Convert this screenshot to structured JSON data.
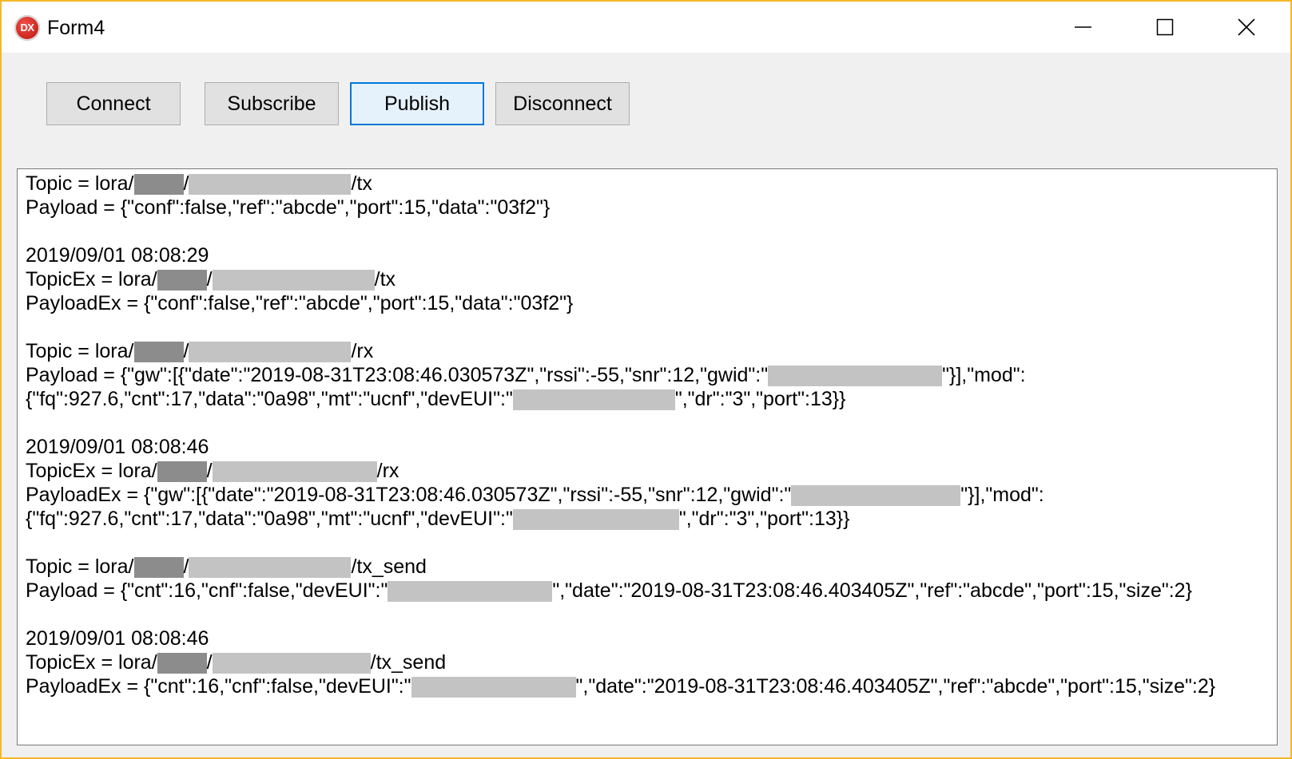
{
  "window": {
    "title": "Form4",
    "icon_label": "DX",
    "accent_color": "#f5b82a"
  },
  "toolbar": {
    "connect_label": "Connect",
    "subscribe_label": "Subscribe",
    "publish_label": "Publish",
    "disconnect_label": "Disconnect"
  },
  "log": {
    "entries": [
      {
        "parts": [
          "Topic = lora/",
          "[redacted-dark]",
          "/",
          "[redacted]",
          "/tx"
        ]
      },
      {
        "parts": [
          "Payload = {\"conf\":false,\"ref\":\"abcde\",\"port\":15,\"data\":\"03f2\"}"
        ]
      },
      {
        "parts": [
          ""
        ]
      },
      {
        "parts": [
          "2019/09/01 08:08:29"
        ]
      },
      {
        "parts": [
          "TopicEx = lora/",
          "[redacted-dark]",
          "/",
          "[redacted]",
          "/tx"
        ]
      },
      {
        "parts": [
          "PayloadEx = {\"conf\":false,\"ref\":\"abcde\",\"port\":15,\"data\":\"03f2\"}"
        ]
      },
      {
        "parts": [
          ""
        ]
      },
      {
        "parts": [
          "Topic = lora/",
          "[redacted-dark]",
          "/",
          "[redacted]",
          "/rx"
        ]
      },
      {
        "parts": [
          "Payload = {\"gw\":[{\"date\":\"2019-08-31T23:08:46.030573Z\",\"rssi\":-55,\"snr\":12,\"gwid\":\"",
          "[redacted]",
          "\"}],\"mod\":"
        ]
      },
      {
        "parts": [
          "{\"fq\":927.6,\"cnt\":17,\"data\":\"0a98\",\"mt\":\"ucnf\",\"devEUI\":\"",
          "[redacted]",
          "\",\"dr\":\"3\",\"port\":13}}"
        ]
      },
      {
        "parts": [
          ""
        ]
      },
      {
        "parts": [
          "2019/09/01 08:08:46"
        ]
      },
      {
        "parts": [
          "TopicEx = lora/",
          "[redacted-dark]",
          "/",
          "[redacted]",
          "/rx"
        ]
      },
      {
        "parts": [
          "PayloadEx = {\"gw\":[{\"date\":\"2019-08-31T23:08:46.030573Z\",\"rssi\":-55,\"snr\":12,\"gwid\":\"",
          "[redacted]",
          "\"}],\"mod\":"
        ]
      },
      {
        "parts": [
          "{\"fq\":927.6,\"cnt\":17,\"data\":\"0a98\",\"mt\":\"ucnf\",\"devEUI\":\"",
          "[redacted]",
          "\",\"dr\":\"3\",\"port\":13}}"
        ]
      },
      {
        "parts": [
          ""
        ]
      },
      {
        "parts": [
          "Topic = lora/",
          "[redacted-dark]",
          "/",
          "[redacted]",
          "/tx_send"
        ]
      },
      {
        "parts": [
          "Payload = {\"cnt\":16,\"cnf\":false,\"devEUI\":\"",
          "[redacted]",
          "\",\"date\":\"2019-08-31T23:08:46.403405Z\",\"ref\":\"abcde\",\"port\":15,\"size\":2}"
        ]
      },
      {
        "parts": [
          ""
        ]
      },
      {
        "parts": [
          "2019/09/01 08:08:46"
        ]
      },
      {
        "parts": [
          "TopicEx = lora/",
          "[redacted-dark]",
          "/",
          "[redacted]",
          "/tx_send"
        ]
      },
      {
        "parts": [
          "PayloadEx = {\"cnt\":16,\"cnf\":false,\"devEUI\":\"",
          "[redacted]",
          "\",\"date\":\"2019-08-31T23:08:46.403405Z\",\"ref\":\"abcde\",\"port\":15,\"size\":2}"
        ]
      }
    ]
  }
}
